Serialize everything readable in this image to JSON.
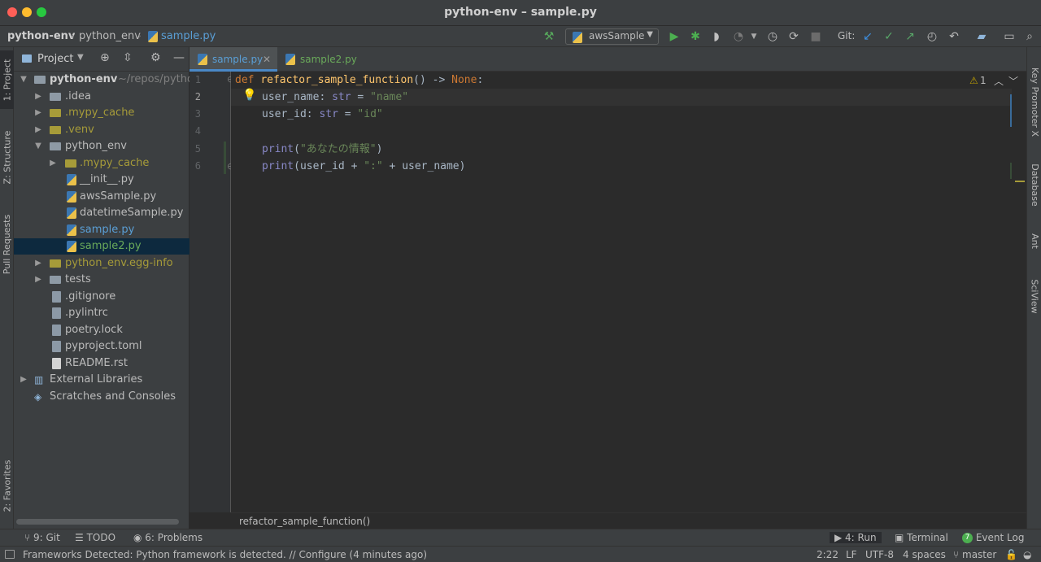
{
  "window": {
    "title": "python-env – sample.py"
  },
  "navbar": {
    "crumbs": [
      "python-env",
      "python_env",
      "sample.py"
    ],
    "run_config": "awsSample",
    "git_label": "Git:"
  },
  "left_stripe": {
    "project": "1: Project",
    "structure": "Z: Structure",
    "pull_requests": "Pull Requests",
    "favorites": "2: Favorites"
  },
  "right_stripe": {
    "key_promoter": "Key Promoter X",
    "database": "Database",
    "ant": "Ant",
    "sciview": "SciView"
  },
  "project_panel": {
    "title": "Project",
    "tree": [
      {
        "label": "python-env",
        "suffix": "~/repos/pytho",
        "type": "root"
      },
      {
        "label": ".idea",
        "type": "folder"
      },
      {
        "label": ".mypy_cache",
        "type": "folder-excluded"
      },
      {
        "label": ".venv",
        "type": "folder-excluded"
      },
      {
        "label": "python_env",
        "type": "folder-open"
      },
      {
        "label": ".mypy_cache",
        "type": "folder-excluded"
      },
      {
        "label": "__init__.py",
        "type": "py"
      },
      {
        "label": "awsSample.py",
        "type": "py"
      },
      {
        "label": "datetimeSample.py",
        "type": "py"
      },
      {
        "label": "sample.py",
        "type": "py-modified"
      },
      {
        "label": "sample2.py",
        "type": "py-added"
      },
      {
        "label": "python_env.egg-info",
        "type": "folder-excluded"
      },
      {
        "label": "tests",
        "type": "folder"
      },
      {
        "label": ".gitignore",
        "type": "file"
      },
      {
        "label": ".pylintrc",
        "type": "file"
      },
      {
        "label": "poetry.lock",
        "type": "file"
      },
      {
        "label": "pyproject.toml",
        "type": "file"
      },
      {
        "label": "README.rst",
        "type": "file"
      },
      {
        "label": "External Libraries",
        "type": "libs"
      },
      {
        "label": "Scratches and Consoles",
        "type": "scratch"
      }
    ]
  },
  "tabs": [
    {
      "label": "sample.py",
      "active": true
    },
    {
      "label": "sample2.py",
      "active": false
    }
  ],
  "editor": {
    "line_numbers": [
      "1",
      "2",
      "3",
      "4",
      "5",
      "6"
    ],
    "lines": [
      {
        "t1": "def",
        "t2": "refactor_sample_function",
        "t3": "() -> ",
        "t4": "None",
        "t5": ":"
      },
      {
        "t1": "user_name: ",
        "t2": "str",
        "t3": " = ",
        "t4": "\"name\""
      },
      {
        "t1": "user_id: ",
        "t2": "str",
        "t3": " = ",
        "t4": "\"id\""
      },
      {},
      {
        "t1": "print",
        "t2": "(",
        "t3": "\"あなたの情報\"",
        "t4": ")"
      },
      {
        "t1": "print",
        "t2": "(user_id + ",
        "t3": "\":\"",
        "t4": " + user_name)"
      }
    ],
    "inspection_count": "1",
    "breadcrumb": "refactor_sample_function()"
  },
  "tool_windows": {
    "git": "9: Git",
    "todo": "TODO",
    "problems": "6: Problems",
    "run": "4: Run",
    "terminal": "Terminal",
    "event_log": "Event Log",
    "event_count": "7"
  },
  "status": {
    "message": "Frameworks Detected: Python framework is detected. // Configure (4 minutes ago)",
    "position": "2:22",
    "line_sep": "LF",
    "encoding": "UTF-8",
    "indent": "4 spaces",
    "branch": "master"
  },
  "colors": {
    "accent": "#4a88c7",
    "keyword": "#cc7832",
    "function": "#ffc66d",
    "string": "#6a8759"
  }
}
